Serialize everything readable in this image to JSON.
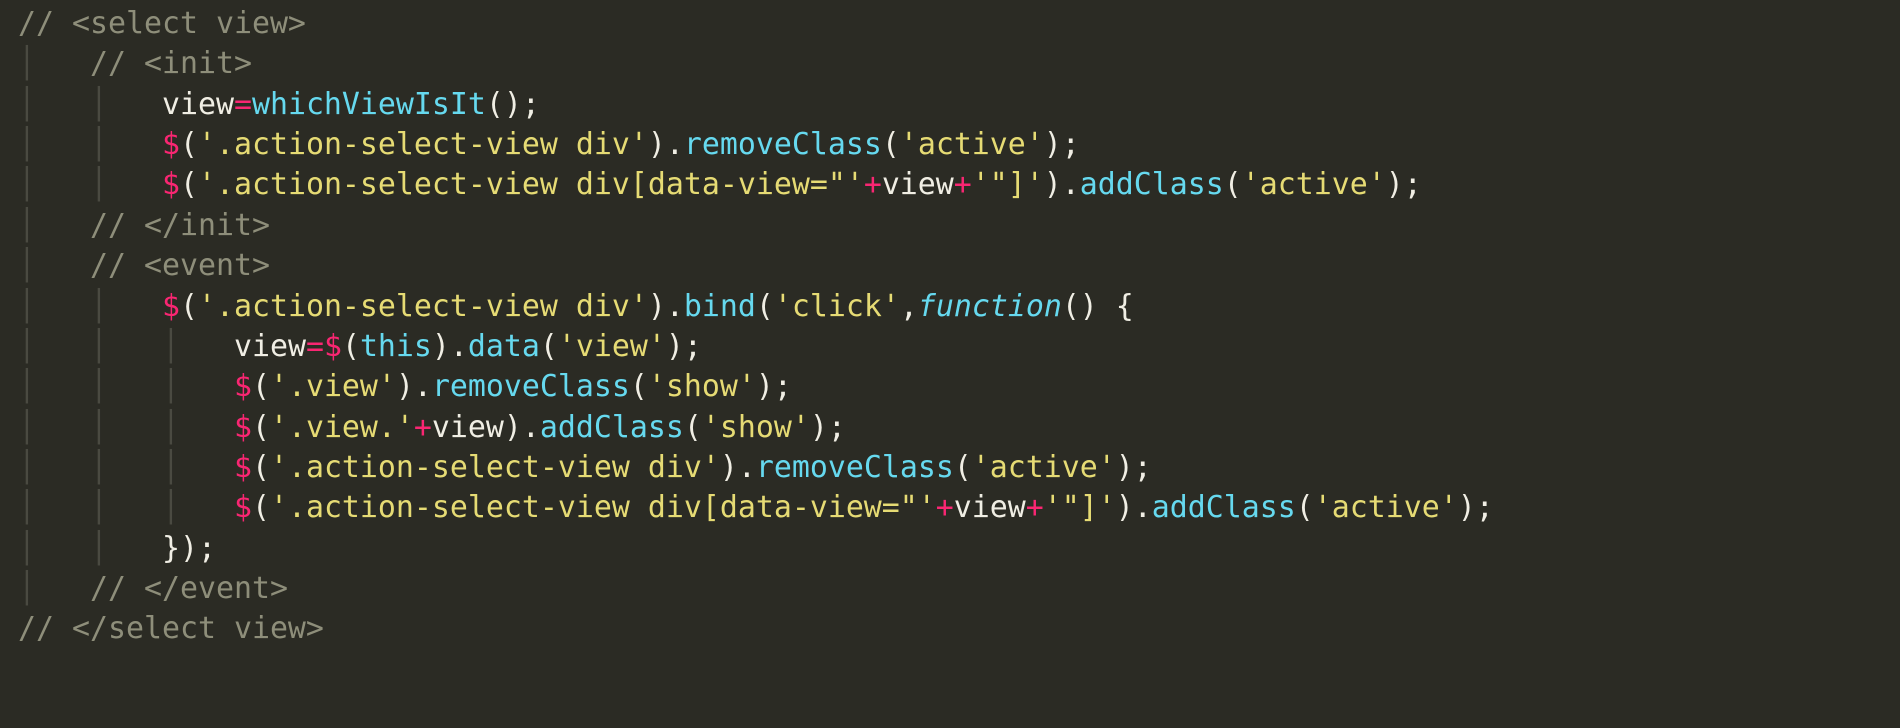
{
  "code": {
    "lines": [
      {
        "indent": "",
        "tokens": [
          {
            "cls": "cm",
            "text": "// <select view>"
          }
        ]
      },
      {
        "indent": "    ",
        "tokens": [
          {
            "cls": "cm",
            "text": "// <init>"
          }
        ]
      },
      {
        "indent": "        ",
        "tokens": [
          {
            "cls": "id",
            "text": "view"
          },
          {
            "cls": "op",
            "text": "="
          },
          {
            "cls": "fn",
            "text": "whichViewIsIt"
          },
          {
            "cls": "id",
            "text": "();"
          }
        ]
      },
      {
        "indent": "        ",
        "tokens": [
          {
            "cls": "op",
            "text": "$"
          },
          {
            "cls": "id",
            "text": "("
          },
          {
            "cls": "str",
            "text": "'.action-select-view div'"
          },
          {
            "cls": "id",
            "text": ")."
          },
          {
            "cls": "fn",
            "text": "removeClass"
          },
          {
            "cls": "id",
            "text": "("
          },
          {
            "cls": "str",
            "text": "'active'"
          },
          {
            "cls": "id",
            "text": ");"
          }
        ]
      },
      {
        "indent": "        ",
        "tokens": [
          {
            "cls": "op",
            "text": "$"
          },
          {
            "cls": "id",
            "text": "("
          },
          {
            "cls": "str",
            "text": "'.action-select-view div[data-view=\"'"
          },
          {
            "cls": "op",
            "text": "+"
          },
          {
            "cls": "id",
            "text": "view"
          },
          {
            "cls": "op",
            "text": "+"
          },
          {
            "cls": "str",
            "text": "'\"]'"
          },
          {
            "cls": "id",
            "text": ")."
          },
          {
            "cls": "fn",
            "text": "addClass"
          },
          {
            "cls": "id",
            "text": "("
          },
          {
            "cls": "str",
            "text": "'active'"
          },
          {
            "cls": "id",
            "text": ");"
          }
        ]
      },
      {
        "indent": "    ",
        "tokens": [
          {
            "cls": "cm",
            "text": "// </init>"
          }
        ]
      },
      {
        "indent": "    ",
        "tokens": [
          {
            "cls": "cm",
            "text": "// <event>"
          }
        ]
      },
      {
        "indent": "        ",
        "tokens": [
          {
            "cls": "op",
            "text": "$"
          },
          {
            "cls": "id",
            "text": "("
          },
          {
            "cls": "str",
            "text": "'.action-select-view div'"
          },
          {
            "cls": "id",
            "text": ")."
          },
          {
            "cls": "fn",
            "text": "bind"
          },
          {
            "cls": "id",
            "text": "("
          },
          {
            "cls": "str",
            "text": "'click'"
          },
          {
            "cls": "id",
            "text": ","
          },
          {
            "cls": "kw",
            "text": "function"
          },
          {
            "cls": "id",
            "text": "() {"
          }
        ]
      },
      {
        "indent": "            ",
        "tokens": [
          {
            "cls": "id",
            "text": "view"
          },
          {
            "cls": "op",
            "text": "="
          },
          {
            "cls": "op",
            "text": "$"
          },
          {
            "cls": "id",
            "text": "("
          },
          {
            "cls": "fn",
            "text": "this"
          },
          {
            "cls": "id",
            "text": ")."
          },
          {
            "cls": "fn",
            "text": "data"
          },
          {
            "cls": "id",
            "text": "("
          },
          {
            "cls": "str",
            "text": "'view'"
          },
          {
            "cls": "id",
            "text": ");"
          }
        ]
      },
      {
        "indent": "            ",
        "tokens": [
          {
            "cls": "op",
            "text": "$"
          },
          {
            "cls": "id",
            "text": "("
          },
          {
            "cls": "str",
            "text": "'.view'"
          },
          {
            "cls": "id",
            "text": ")."
          },
          {
            "cls": "fn",
            "text": "removeClass"
          },
          {
            "cls": "id",
            "text": "("
          },
          {
            "cls": "str",
            "text": "'show'"
          },
          {
            "cls": "id",
            "text": ");"
          }
        ]
      },
      {
        "indent": "            ",
        "tokens": [
          {
            "cls": "op",
            "text": "$"
          },
          {
            "cls": "id",
            "text": "("
          },
          {
            "cls": "str",
            "text": "'.view.'"
          },
          {
            "cls": "op",
            "text": "+"
          },
          {
            "cls": "id",
            "text": "view)."
          },
          {
            "cls": "fn",
            "text": "addClass"
          },
          {
            "cls": "id",
            "text": "("
          },
          {
            "cls": "str",
            "text": "'show'"
          },
          {
            "cls": "id",
            "text": ");"
          }
        ]
      },
      {
        "indent": "            ",
        "tokens": [
          {
            "cls": "op",
            "text": "$"
          },
          {
            "cls": "id",
            "text": "("
          },
          {
            "cls": "str",
            "text": "'.action-select-view div'"
          },
          {
            "cls": "id",
            "text": ")."
          },
          {
            "cls": "fn",
            "text": "removeClass"
          },
          {
            "cls": "id",
            "text": "("
          },
          {
            "cls": "str",
            "text": "'active'"
          },
          {
            "cls": "id",
            "text": ");"
          }
        ]
      },
      {
        "indent": "            ",
        "tokens": [
          {
            "cls": "op",
            "text": "$"
          },
          {
            "cls": "id",
            "text": "("
          },
          {
            "cls": "str",
            "text": "'.action-select-view div[data-view=\"'"
          },
          {
            "cls": "op",
            "text": "+"
          },
          {
            "cls": "id",
            "text": "view"
          },
          {
            "cls": "op",
            "text": "+"
          },
          {
            "cls": "str",
            "text": "'\"]'"
          },
          {
            "cls": "id",
            "text": ")."
          },
          {
            "cls": "fn",
            "text": "addClass"
          },
          {
            "cls": "id",
            "text": "("
          },
          {
            "cls": "str",
            "text": "'active'"
          },
          {
            "cls": "id",
            "text": ");"
          }
        ]
      },
      {
        "indent": "        ",
        "tokens": [
          {
            "cls": "id",
            "text": "});"
          }
        ]
      },
      {
        "indent": "    ",
        "tokens": [
          {
            "cls": "cm",
            "text": "// </event>"
          }
        ]
      },
      {
        "indent": "",
        "tokens": [
          {
            "cls": "cm",
            "text": "// </select view>"
          }
        ]
      }
    ],
    "indent_unit": 4,
    "guide_char": "│",
    "left_margin": " "
  }
}
